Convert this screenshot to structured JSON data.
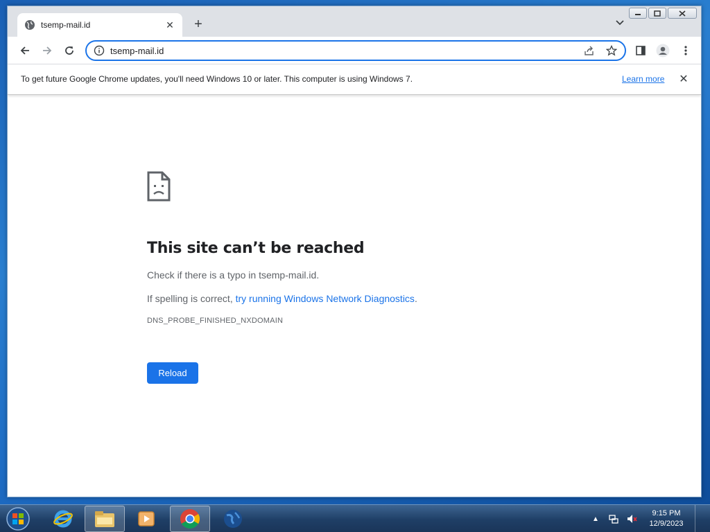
{
  "browser": {
    "tab": {
      "title": "tsemp-mail.id"
    },
    "omnibox": {
      "url": "tsemp-mail.id"
    }
  },
  "infobar": {
    "message": "To get future Google Chrome updates, you'll need Windows 10 or later. This computer is using Windows 7.",
    "link": "Learn more"
  },
  "error_page": {
    "heading": "This site can’t be reached",
    "typo_prefix": "Check if there is a typo in ",
    "typo_domain": "tsemp-mail.id",
    "typo_suffix": ".",
    "spelling_prefix": "If spelling is correct, ",
    "diagnostics_link": "try running Windows Network Diagnostics",
    "spelling_suffix": ".",
    "error_code": "DNS_PROBE_FINISHED_NXDOMAIN",
    "reload_label": "Reload"
  },
  "taskbar": {
    "apps": [
      "internet-explorer-icon",
      "file-explorer-icon",
      "media-player-icon",
      "chrome-icon",
      "globe-icon"
    ],
    "clock": {
      "time": "9:15 PM",
      "date": "12/9/2023"
    }
  },
  "colors": {
    "accent": "#1a73e8",
    "text": "#202124",
    "secondary_text": "#5f6368"
  }
}
